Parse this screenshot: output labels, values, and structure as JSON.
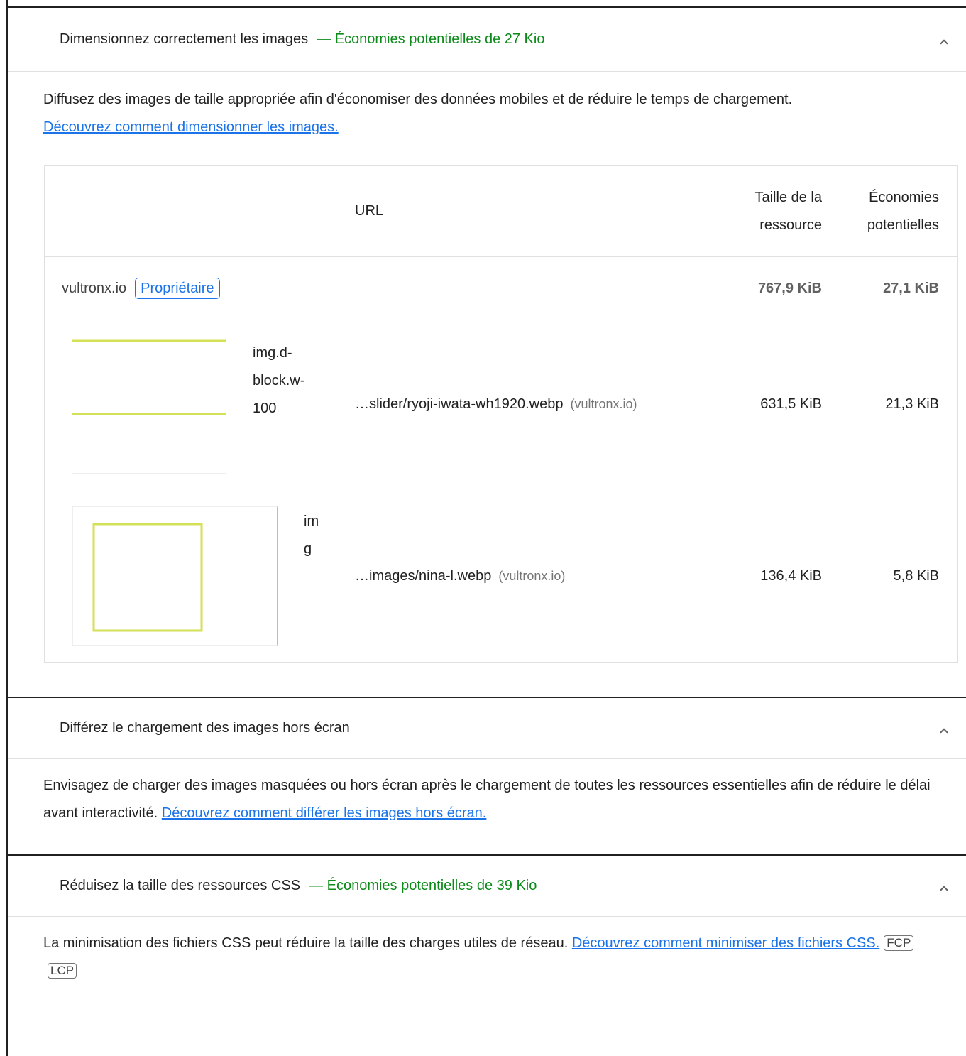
{
  "audits": [
    {
      "title": "Dimensionnez correctement les images",
      "savings": "— Économies potentielles de 27 Kio",
      "description": "Diffusez des images de taille appropriée afin d'économiser des données mobiles et de réduire le temps de chargement. ",
      "link": "Découvrez comment dimensionner les images.",
      "table": {
        "headers": {
          "url": "URL",
          "size_line1": "Taille de la",
          "size_line2": "ressource",
          "save_line1": "Économies",
          "save_line2": "potentielles"
        },
        "group": {
          "name": "vultronx.io",
          "badge": "Propriétaire",
          "size": "767,9 KiB",
          "savings": "27,1 KiB"
        },
        "rows": [
          {
            "node_l1": "img.d-",
            "node_l2": "block.w-",
            "node_l3": "100",
            "url": "…slider/ryoji-iwata-wh1920.webp",
            "host": "(vultronx.io)",
            "size": "631,5 KiB",
            "savings": "21,3 KiB"
          },
          {
            "node_l1": "im",
            "node_l2": "g",
            "url": "…images/nina-l.webp",
            "host": "(vultronx.io)",
            "size": "136,4 KiB",
            "savings": "5,8 KiB"
          }
        ]
      }
    },
    {
      "title": "Différez le chargement des images hors écran",
      "description": "Envisagez de charger des images masquées ou hors écran après le chargement de toutes les ressources essentielles afin de réduire le délai avant interactivité. ",
      "link": "Découvrez comment différer les images hors écran."
    },
    {
      "title": "Réduisez la taille des ressources CSS",
      "savings": "— Économies potentielles de 39 Kio",
      "description": "La minimisation des fichiers CSS peut réduire la taille des charges utiles de réseau. ",
      "link": "Découvrez comment minimiser des fichiers CSS.",
      "badges": [
        "FCP",
        "LCP"
      ]
    }
  ],
  "icons": {
    "collapse": "chevron-up-icon"
  },
  "colors": {
    "savings": "#0c8a1a",
    "link": "#1a73e8",
    "thumb_accent": "#d4e157"
  }
}
